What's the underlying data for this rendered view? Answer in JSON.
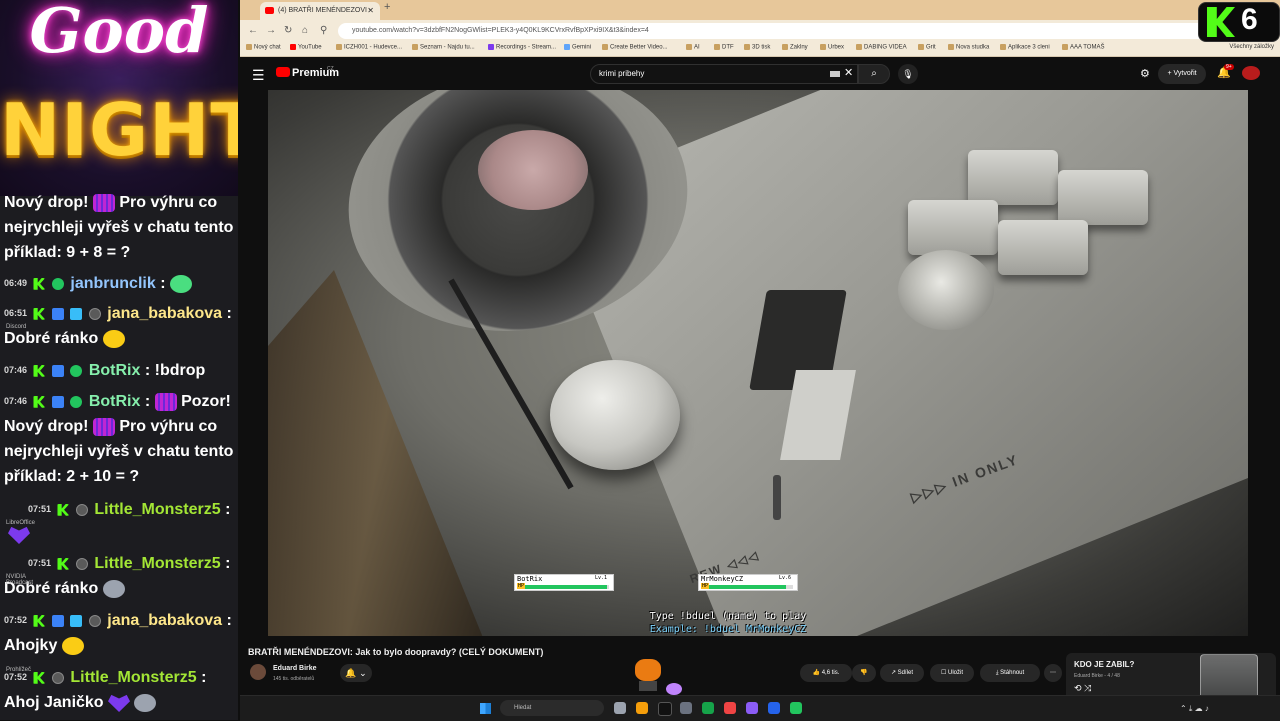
{
  "overlay": {
    "good": "Good",
    "night": "NIGHT"
  },
  "chat": {
    "messages": [
      {
        "text1": "Nový drop!",
        "text2": "Pro výhru co",
        "line2": "nejrychleji vyřeš v chatu tento",
        "line3": "příklad: 9 + 8 = ?"
      },
      {
        "time": "06:49",
        "user": "janbrunclik",
        "sep": ":"
      },
      {
        "time": "06:51",
        "user": "jana_babakova",
        "sep": ":",
        "text": "Dobré ránko"
      },
      {
        "time": "07:46",
        "user": "BotRix",
        "sep": ":",
        "text": "!bdrop"
      },
      {
        "time": "07:46",
        "user": "BotRix",
        "sep": ":",
        "text": "Pozor!",
        "line2": "Nový drop!",
        "line2b": "Pro výhru co",
        "line3": "nejrychleji vyřeš v chatu tento",
        "line4": "příklad: 2 + 10 = ?"
      },
      {
        "time": "07:51",
        "user": "Little_Monsterz5",
        "sep": ":"
      },
      {
        "time": "07:51",
        "user": "Little_Monsterz5",
        "sep": ":",
        "text": "Dobré ránko"
      },
      {
        "time": "07:52",
        "user": "jana_babakova",
        "sep": ":",
        "text": "Ahojky"
      },
      {
        "time": "07:52",
        "user": "Little_Monsterz5",
        "sep": ":",
        "text": "Ahoj Janičko"
      }
    ],
    "side_labels": [
      "Discord",
      "LibreOffice",
      "NVIDIA Broadcast",
      "Prohlížeč"
    ]
  },
  "browser": {
    "tab_title": "(4) BRATŘI MENÉNDEZOVI - Ja...",
    "url": "youtube.com/watch?v=3dzbfFN2NogGWlist=PLEK3-y4Q0KL9KCVrxRvfBpXPxi9IX&t3&index=4",
    "bookmarks": [
      "Nový chat",
      "YouTube",
      "ICZH001 - Hudevce...",
      "Seznam - Najdu tu...",
      "Recordings - Stream...",
      "Gemini",
      "Create Better Video...",
      "AI",
      "DTF",
      "3D tisk",
      "Zaklny",
      "Urbex",
      "DABING VIDEA",
      "Grit",
      "Nova studka",
      "Aplikace 3 cleni",
      "AAA TOMAŠ"
    ],
    "all_bookmarks": "Všechny záložky"
  },
  "youtube": {
    "brand": "Premium",
    "brand_cc": "CZ",
    "search_value": "krimi pribehy",
    "create_label": "Vytvořit",
    "notif_count": "9+",
    "video_title": "BRATŘI MENÉNDEZOVI: Jak to bylo doopravdy? (CELÝ DOKUMENT)",
    "channel_name": "Eduard Birke",
    "channel_subs": "145 tis. odběratelů",
    "likes": "4,6 tis.",
    "share": "Sdílet",
    "save": "Uložit",
    "download": "Stáhnout",
    "playlist_title": "KDO JE ZABIL?",
    "playlist_sub": "Eduard Birke - 4 / 48"
  },
  "duel": {
    "p1_name": "BotRix",
    "p1_lv": "Lv.1",
    "p1_hp": 0.98,
    "p2_name": "MrMonkeyCZ",
    "p2_lv": "Lv.6",
    "p2_hp": 0.92,
    "hp_label": "HP",
    "instruction": "Type !bduel (name) to play",
    "example": "Example: !bduel MrMonkeyCZ"
  },
  "kick_badge": {
    "count": "6"
  },
  "taskbar": {
    "search_placeholder": "Hledat"
  },
  "colors": {
    "kick_green": "#53fc18",
    "yt_red": "#ff0000"
  }
}
